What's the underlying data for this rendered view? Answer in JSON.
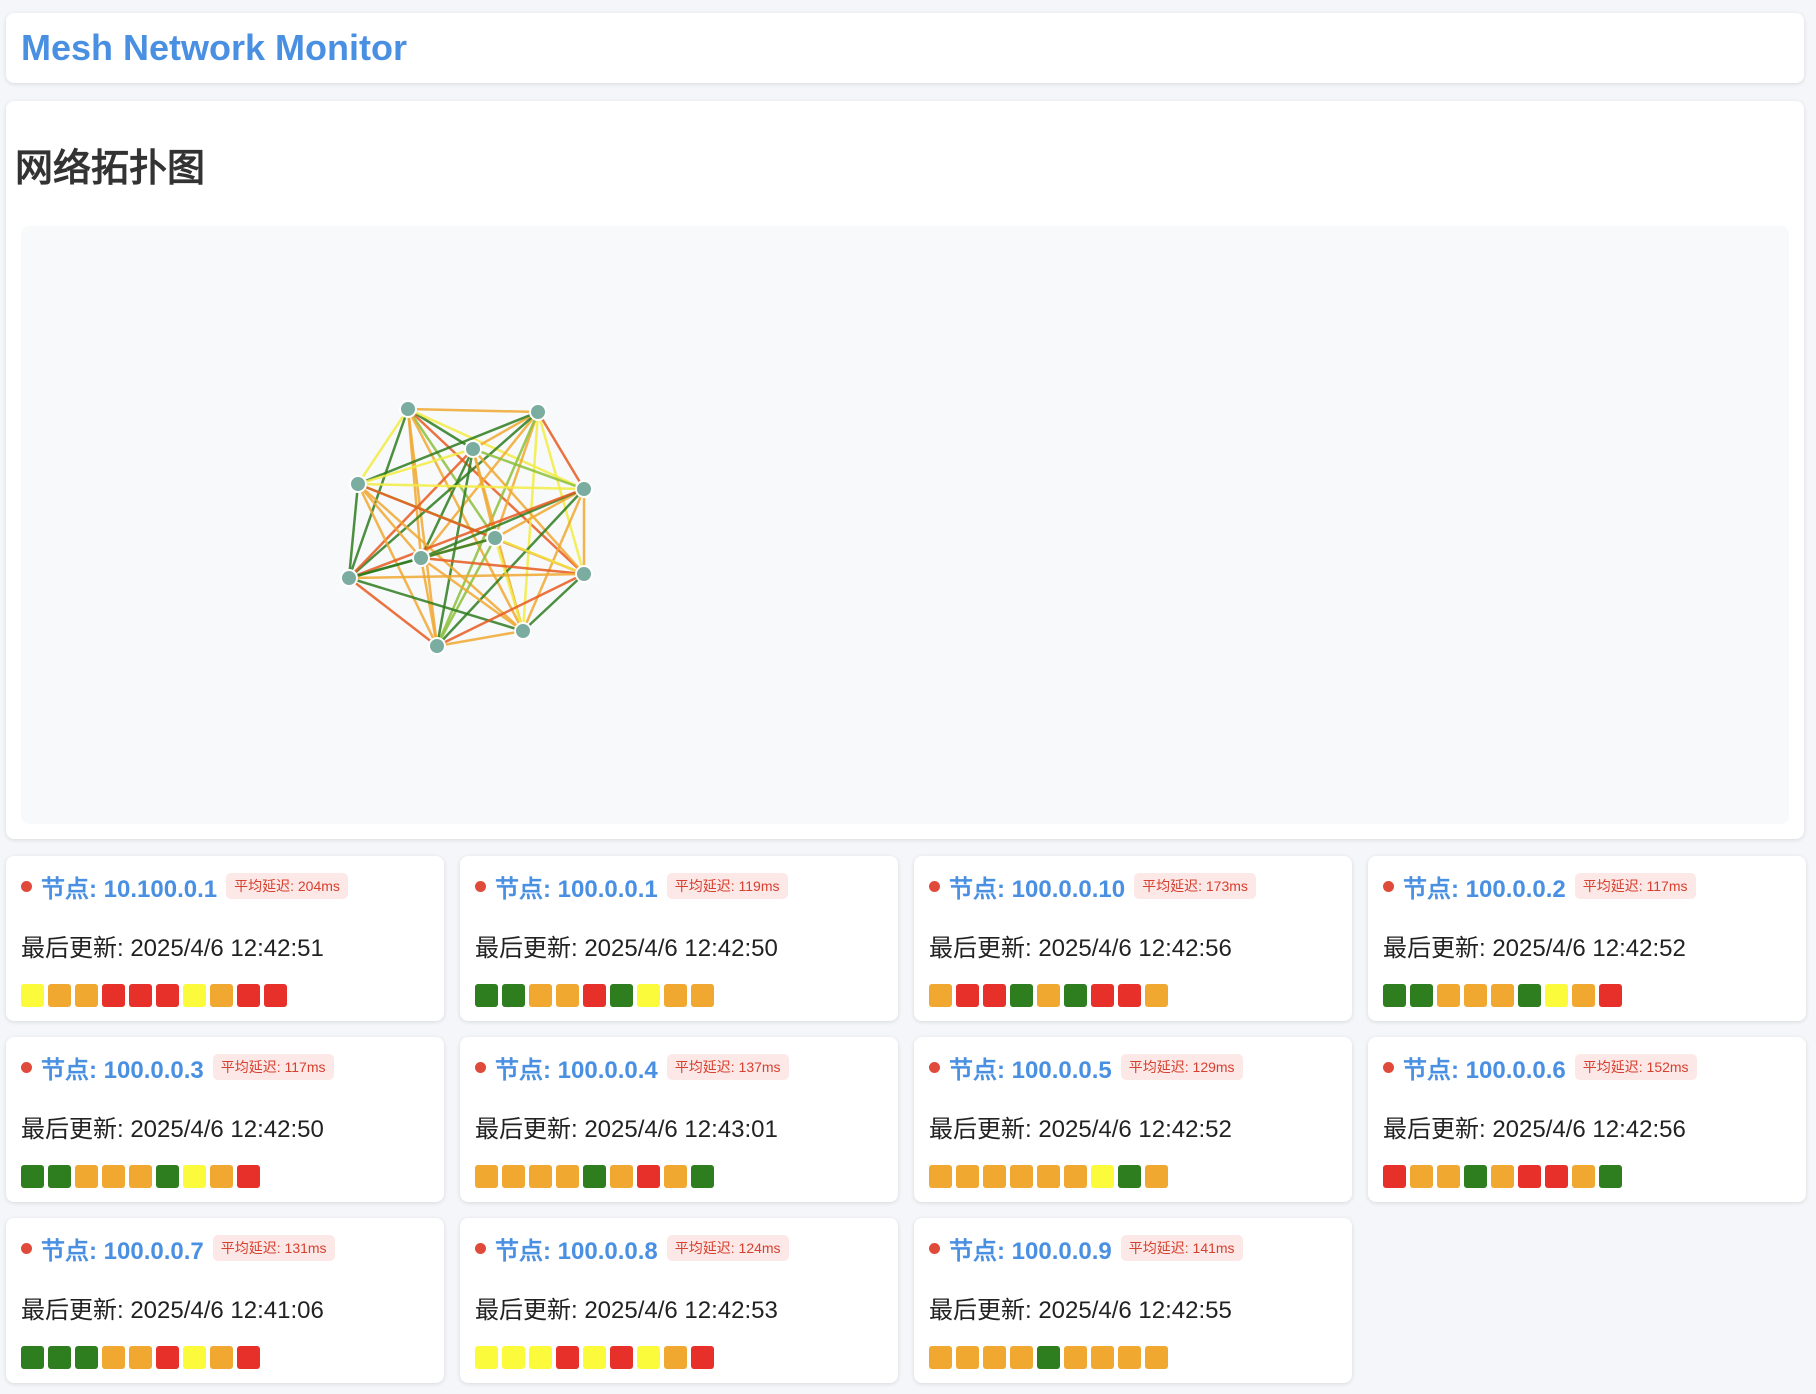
{
  "app": {
    "title": "Mesh Network Monitor"
  },
  "topology": {
    "title": "网络拓扑图",
    "node_color": "#7aada0",
    "link_colors": {
      "good": "#2e7d1e",
      "medium_good": "#8bbf3a",
      "medium": "#f2ec42",
      "slow": "#f0a830",
      "bad": "#e85a20"
    }
  },
  "status_colors": {
    "green": "#2e7d1e",
    "yellow": "#fbfb3c",
    "orange": "#f0a830",
    "red": "#e8302a",
    "offline_dot": "#e04a3a"
  },
  "nodes": [
    {
      "title": "节点: 10.100.0.1",
      "latency": "平均延迟: 204ms",
      "updated": "最后更新: 2025/4/6 12:42:51",
      "history": [
        "yellow",
        "orange",
        "orange",
        "red",
        "red",
        "red",
        "yellow",
        "orange",
        "red",
        "red"
      ]
    },
    {
      "title": "节点: 100.0.0.1",
      "latency": "平均延迟: 119ms",
      "updated": "最后更新: 2025/4/6 12:42:50",
      "history": [
        "green",
        "green",
        "orange",
        "orange",
        "red",
        "green",
        "yellow",
        "orange",
        "orange"
      ]
    },
    {
      "title": "节点: 100.0.0.10",
      "latency": "平均延迟: 173ms",
      "updated": "最后更新: 2025/4/6 12:42:56",
      "history": [
        "orange",
        "red",
        "red",
        "green",
        "orange",
        "green",
        "red",
        "red",
        "orange"
      ]
    },
    {
      "title": "节点: 100.0.0.2",
      "latency": "平均延迟: 117ms",
      "updated": "最后更新: 2025/4/6 12:42:52",
      "history": [
        "green",
        "green",
        "orange",
        "orange",
        "orange",
        "green",
        "yellow",
        "orange",
        "red"
      ]
    },
    {
      "title": "节点: 100.0.0.3",
      "latency": "平均延迟: 117ms",
      "updated": "最后更新: 2025/4/6 12:42:50",
      "history": [
        "green",
        "green",
        "orange",
        "orange",
        "orange",
        "green",
        "yellow",
        "orange",
        "red"
      ]
    },
    {
      "title": "节点: 100.0.0.4",
      "latency": "平均延迟: 137ms",
      "updated": "最后更新: 2025/4/6 12:43:01",
      "history": [
        "orange",
        "orange",
        "orange",
        "orange",
        "green",
        "orange",
        "red",
        "orange",
        "green"
      ]
    },
    {
      "title": "节点: 100.0.0.5",
      "latency": "平均延迟: 129ms",
      "updated": "最后更新: 2025/4/6 12:42:52",
      "history": [
        "orange",
        "orange",
        "orange",
        "orange",
        "orange",
        "orange",
        "yellow",
        "green",
        "orange"
      ]
    },
    {
      "title": "节点: 100.0.0.6",
      "latency": "平均延迟: 152ms",
      "updated": "最后更新: 2025/4/6 12:42:56",
      "history": [
        "red",
        "orange",
        "orange",
        "green",
        "orange",
        "red",
        "red",
        "orange",
        "green"
      ]
    },
    {
      "title": "节点: 100.0.0.7",
      "latency": "平均延迟: 131ms",
      "updated": "最后更新: 2025/4/6 12:41:06",
      "history": [
        "green",
        "green",
        "green",
        "orange",
        "orange",
        "red",
        "yellow",
        "orange",
        "red"
      ]
    },
    {
      "title": "节点: 100.0.0.8",
      "latency": "平均延迟: 124ms",
      "updated": "最后更新: 2025/4/6 12:42:53",
      "history": [
        "yellow",
        "yellow",
        "yellow",
        "red",
        "yellow",
        "red",
        "yellow",
        "orange",
        "red"
      ]
    },
    {
      "title": "节点: 100.0.0.9",
      "latency": "平均延迟: 141ms",
      "updated": "最后更新: 2025/4/6 12:42:55",
      "history": [
        "orange",
        "orange",
        "orange",
        "orange",
        "green",
        "orange",
        "orange",
        "orange",
        "orange"
      ]
    }
  ]
}
